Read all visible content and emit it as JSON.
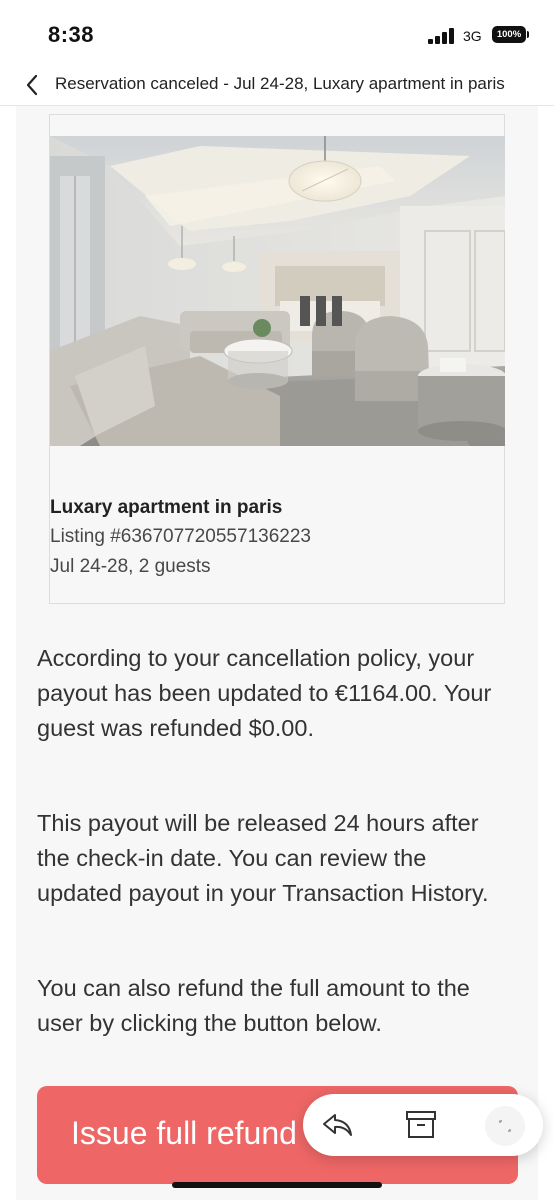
{
  "status_bar": {
    "time": "8:38",
    "network": "3G",
    "battery": "100%",
    "icons": [
      "signal-icon",
      "battery-icon"
    ]
  },
  "header": {
    "back_icon": "chevron-left-icon",
    "title": "Reservation canceled - Jul 24-28, Luxary apartment in paris"
  },
  "listing": {
    "photo_alt": "living-room-photo",
    "name": "Luxary apartment in paris",
    "listing_number": "Listing #636707720557136223",
    "dates_guests": "Jul 24-28, 2 guests"
  },
  "message": {
    "paragraph_1": "According to your cancellation policy, your payout has been updated to €1164.00. Your guest was refunded $0.00.",
    "paragraph_2": "This payout will be released 24 hours after the check-in date. You can review the updated payout in your Transaction History.",
    "paragraph_3": "You can also refund the full amount to the user by clicking the button below."
  },
  "refund_button": {
    "label": "Issue full refund",
    "color": "#ee6766"
  },
  "floating_toolbar": {
    "icons": [
      "reply-icon",
      "archive-icon",
      "expand-icon"
    ]
  }
}
